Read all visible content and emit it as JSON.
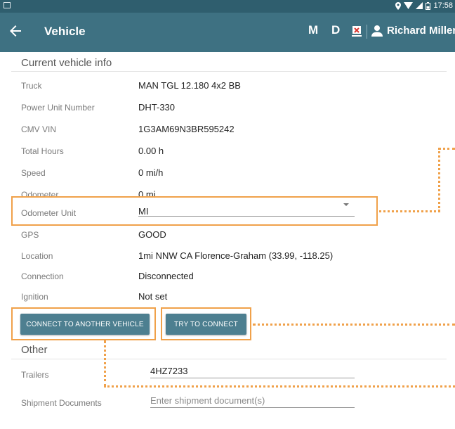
{
  "status_bar": {
    "time": "17:58"
  },
  "app_bar": {
    "title": "Vehicle",
    "m_label": "M",
    "d_label": "D",
    "user_name": "Richard Miller"
  },
  "current_vehicle": {
    "section_title": "Current vehicle info",
    "rows": [
      {
        "label": "Truck",
        "value": "MAN TGL 12.180 4x2 BB"
      },
      {
        "label": "Power Unit Number",
        "value": "DHT-330"
      },
      {
        "label": "CMV VIN",
        "value": "1G3AM69N3BR595242"
      },
      {
        "label": "Total Hours",
        "value": "0.00 h"
      },
      {
        "label": "Speed",
        "value": "0 mi/h"
      },
      {
        "label": "Odometer",
        "value": "0 mi"
      },
      {
        "label": "Odometer Unit",
        "value": "MI"
      },
      {
        "label": "GPS",
        "value": "GOOD"
      },
      {
        "label": "Location",
        "value": "1mi NNW CA Florence-Graham (33.99, -118.25)"
      },
      {
        "label": "Connection",
        "value": "Disconnected"
      },
      {
        "label": "Ignition",
        "value": "Not set"
      }
    ]
  },
  "buttons": {
    "connect_another": "CONNECT TO ANOTHER VEHICLE",
    "try_connect": "TRY TO CONNECT"
  },
  "other": {
    "section_title": "Other",
    "trailers_label": "Trailers",
    "trailers_value": "4HZ7233",
    "shipment_label": "Shipment Documents",
    "shipment_placeholder": "Enter shipment document(s)"
  },
  "colors": {
    "status_bar": "#2f5e6e",
    "app_bar": "#3e7182",
    "button": "#4d7f90",
    "highlight": "#f0a14a"
  },
  "icons": [
    "image-icon",
    "location-icon",
    "wifi-icon",
    "signal-icon",
    "battery-icon",
    "back-arrow-icon",
    "eld-icon",
    "person-icon",
    "dropdown-arrow-icon"
  ]
}
